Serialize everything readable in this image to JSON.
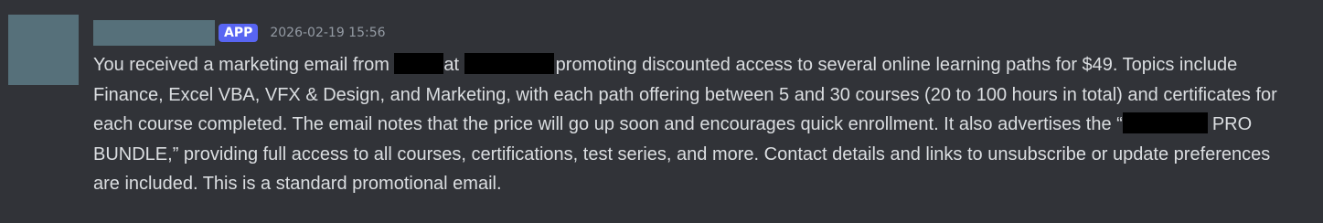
{
  "message": {
    "badge": "APP",
    "timestamp": "2026-02-19 15:56",
    "text_1": "You received a marketing email from ",
    "text_2": "at ",
    "text_3": "promoting discounted access to several online learning paths for $49. Topics include Finance, Excel VBA, VFX & Design, and Marketing, with each path offering between 5 and 30 courses (20 to 100 hours in total) and certificates for each course completed. The email notes that the price will go up soon and encourages quick enrollment. It also advertises the “",
    "text_4": "PRO BUNDLE,” providing full access to all courses, certifications, test series, and more. Contact details and links to unsubscribe or update preferences are included. This is a standard promotional email."
  },
  "colors": {
    "background": "#313338",
    "avatar": "#56707a",
    "badge": "#5865f2",
    "text": "#dbdee1",
    "timestamp": "#949ba4"
  }
}
